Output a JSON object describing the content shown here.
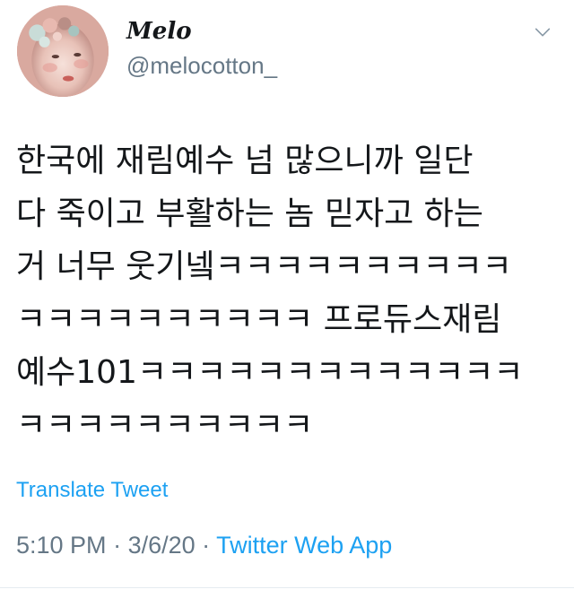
{
  "author": {
    "display_name": "Melo",
    "handle": "@melocotton_"
  },
  "tweet": {
    "lines": [
      "한국에 재림예수 넘 많으니까 일단",
      "다 죽이고 부활하는 놈 믿자고 하는",
      "거 너무 웃기넼ㅋㅋㅋㅋㅋㅋㅋㅋㅋㅋ",
      "ㅋㅋㅋㅋㅋㅋㅋㅋㅋㅋ 프로듀스재림",
      "예수101ㅋㅋㅋㅋㅋㅋㅋㅋㅋㅋㅋㅋㅋ",
      "ㅋㅋㅋㅋㅋㅋㅋㅋㅋㅋ"
    ]
  },
  "actions": {
    "translate_label": "Translate Tweet"
  },
  "meta": {
    "time": "5:10 PM",
    "separator": " · ",
    "date": "3/6/20",
    "source": "Twitter Web App"
  },
  "icons": {
    "menu": "chevron-down-icon"
  },
  "colors": {
    "link": "#1da1f2",
    "secondary_text": "#657786",
    "primary_text": "#14171a"
  }
}
